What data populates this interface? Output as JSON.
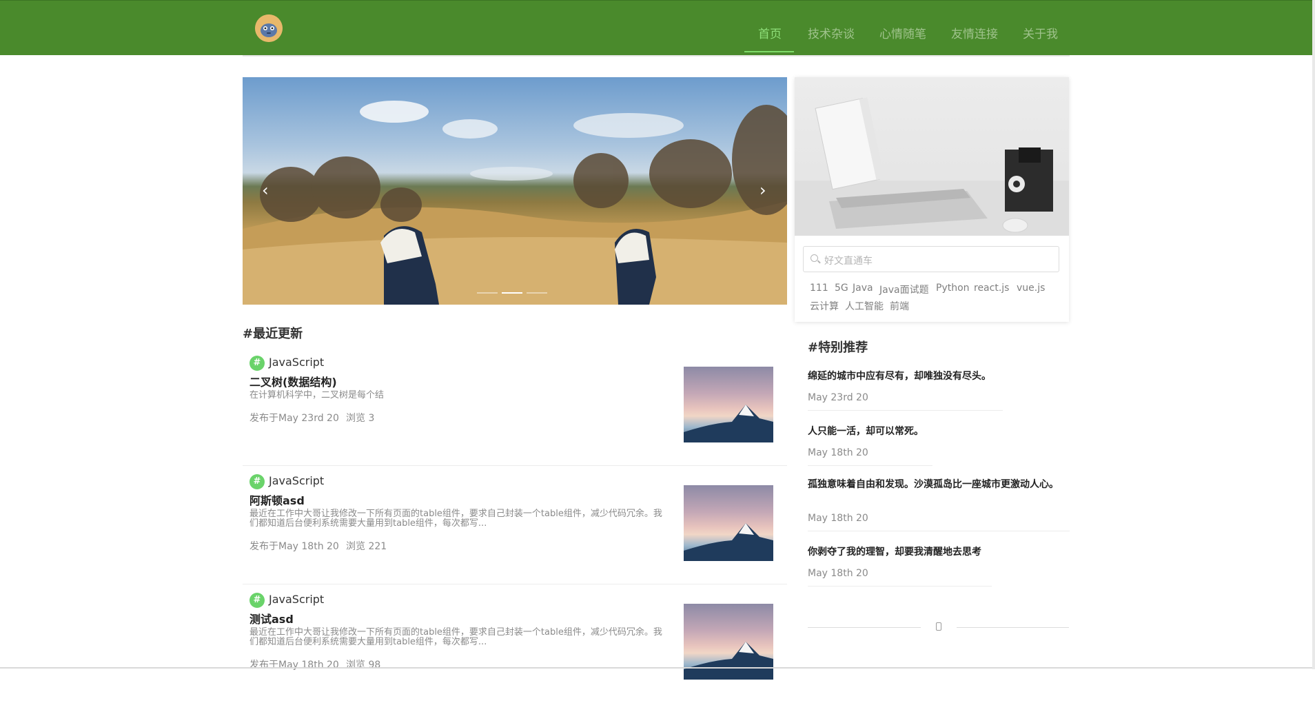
{
  "nav": {
    "items": [
      {
        "label": "首页",
        "active": true
      },
      {
        "label": "技术杂谈",
        "active": false
      },
      {
        "label": "心情随笔",
        "active": false
      },
      {
        "label": "友情连接",
        "active": false
      },
      {
        "label": "关于我",
        "active": false
      }
    ]
  },
  "carousel": {
    "prev": "‹",
    "next": "›",
    "slides": 3,
    "active_slide": 2
  },
  "recent": {
    "title": "#最近更新",
    "articles": [
      {
        "tag": "JavaScript",
        "title": "二叉树(数据结构)",
        "summary": "在计算机科学中，二叉树是每个结",
        "published": "发布于May 23rd 20",
        "views": "浏览 3"
      },
      {
        "tag": "JavaScript",
        "title": "阿斯顿asd",
        "summary": "最近在工作中大哥让我修改一下所有页面的table组件，要求自己封装一个table组件，减少代码冗余。我们都知道后台便利系统需要大量用到table组件，每次都写...",
        "published": "发布于May 18th 20",
        "views": "浏览 221"
      },
      {
        "tag": "JavaScript",
        "title": "测试asd",
        "summary": "最近在工作中大哥让我修改一下所有页面的table组件，要求自己封装一个table组件，减少代码冗余。我们都知道后台便利系统需要大量用到table组件，每次都写...",
        "published": "发布于May 18th 20",
        "views": "浏览 98"
      }
    ]
  },
  "sidebar": {
    "search_placeholder": "好文直通车",
    "tags": [
      "111",
      "5G",
      "Java",
      "Java面试题",
      "Python",
      "react.js",
      "vue.js",
      "云计算",
      "人工智能",
      "前端"
    ]
  },
  "featured": {
    "title": "#特别推荐",
    "items": [
      {
        "title": "绵延的城市中应有尽有，却唯独没有尽头。",
        "date": "May 23rd 20"
      },
      {
        "title": "人只能一活，却可以常死。",
        "date": "May 18th 20"
      },
      {
        "title": "孤独意味着自由和发现。沙漠孤岛比一座城市更激动人心。",
        "date": "May 18th 20"
      },
      {
        "title": "你剥夺了我的理智，却要我清醒地去思考",
        "date": "May 18th 20"
      }
    ]
  },
  "colors": {
    "header": "#4a8a2c",
    "nav_active": "#8fe07a",
    "tag_badge": "#6ad36a"
  }
}
